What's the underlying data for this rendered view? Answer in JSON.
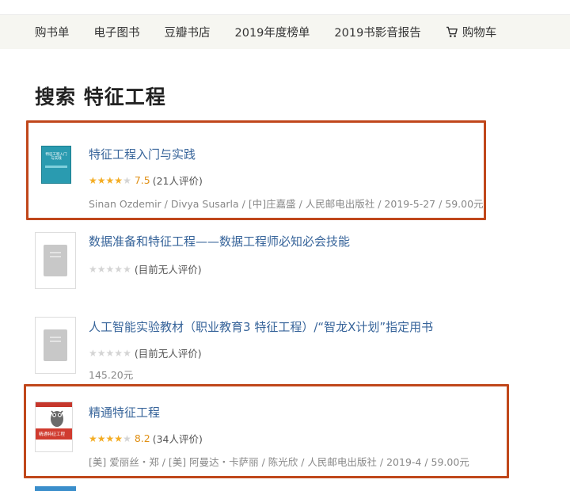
{
  "nav": {
    "items": [
      "购书单",
      "电子图书",
      "豆瓣书店",
      "2019年度榜单",
      "2019书影音报告"
    ],
    "cart_label": "购物车",
    "cart_icon": "cart-icon"
  },
  "page": {
    "title": "搜索 特征工程"
  },
  "results": [
    {
      "title": "特征工程入门与实践",
      "stars": 4,
      "rating": "7.5",
      "count": "(21人评价)",
      "meta": "Sinan Ozdemir / Divya Susarla / [中]庄嘉盛 / 人民邮电出版社 / 2019-5-27 / 59.00元",
      "cover_title": "特征工程入门与实践",
      "highlighted": true
    },
    {
      "title": "数据准备和特征工程——数据工程师必知必会技能",
      "stars": 0,
      "rating": "",
      "count": "(目前无人评价)",
      "meta": "",
      "highlighted": false
    },
    {
      "title": "人工智能实验教材（职业教育3 特征工程）/“智龙X计划”指定用书",
      "stars": 0,
      "rating": "",
      "count": "(目前无人评价)",
      "meta": "145.20元",
      "highlighted": false
    },
    {
      "title": "精通特征工程",
      "stars": 4,
      "rating": "8.2",
      "count": "(34人评价)",
      "meta": "[美] 爱丽丝・郑 / [美] 阿曼达・卡萨丽 / 陈光欣 / 人民邮电出版社 / 2019-4 / 59.00元",
      "cover_title": "精通特征工程",
      "highlighted": true
    }
  ],
  "colors": {
    "link": "#37649a",
    "star_on": "#f4ad24",
    "star_off": "#d4d4d4",
    "highlight_border": "#c0471b",
    "nav_bg": "#f6f6f1"
  }
}
